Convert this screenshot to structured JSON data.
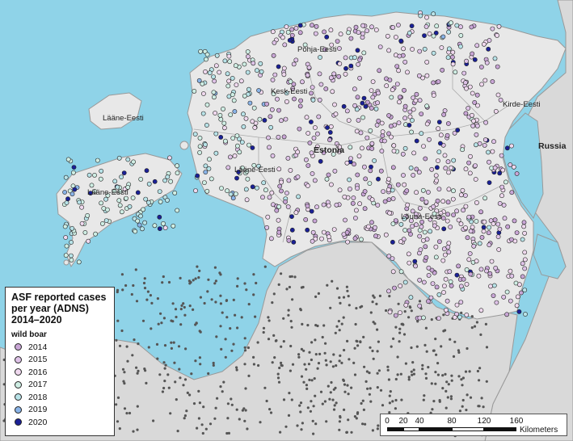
{
  "map": {
    "colors": {
      "sea": "#8fd3e8",
      "estonia": "#e8e8e8",
      "neighbors": "#d9d9d9",
      "border": "#999999",
      "latvia_points": "#555555"
    },
    "labels": {
      "country_main": "Estonia",
      "country_east": "Russia",
      "region_north": "Põhja-Eesti",
      "region_northeast": "Kirde-Eesti",
      "region_west": "Lääne-Eesti",
      "region_central": "Kesk-Eesti",
      "region_southwest": "Lääne-Eesti",
      "region_island": "Lääne-Eesti",
      "region_south": "Lõuna-Eesti"
    }
  },
  "legend": {
    "title": "ASF reported cases\nper year (ADNS)\n2014–2020",
    "subtitle": "wild boar",
    "items": [
      {
        "label": "2014",
        "color": "#c9a6d6"
      },
      {
        "label": "2015",
        "color": "#dfc3e8"
      },
      {
        "label": "2016",
        "color": "#f0d9ef"
      },
      {
        "label": "2017",
        "color": "#cfeee4"
      },
      {
        "label": "2018",
        "color": "#b8e3e8"
      },
      {
        "label": "2019",
        "color": "#8ab4e8"
      },
      {
        "label": "2020",
        "color": "#1a2096"
      }
    ]
  },
  "scalebar": {
    "ticks": [
      "0",
      "20",
      "40",
      "80",
      "120",
      "160"
    ],
    "units": "Kilometers"
  }
}
